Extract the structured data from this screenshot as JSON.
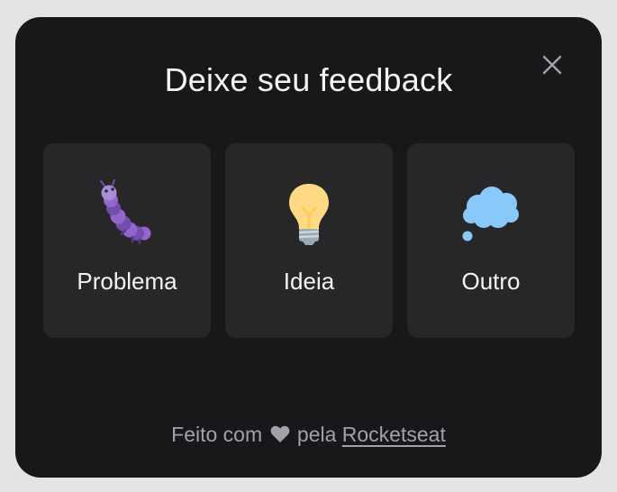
{
  "header": {
    "title": "Deixe seu feedback",
    "close_icon": "close-icon"
  },
  "options": [
    {
      "label": "Problema",
      "icon": "bug-icon"
    },
    {
      "label": "Ideia",
      "icon": "lightbulb-icon"
    },
    {
      "label": "Outro",
      "icon": "thought-balloon-icon"
    }
  ],
  "footer": {
    "prefix": "Feito com",
    "heart_icon": "heart-icon",
    "middle": "pela",
    "link": "Rocketseat"
  },
  "colors": {
    "background": "#18181b",
    "card": "#27272a",
    "text": "#f4f4f5",
    "muted": "#a1a1aa"
  }
}
